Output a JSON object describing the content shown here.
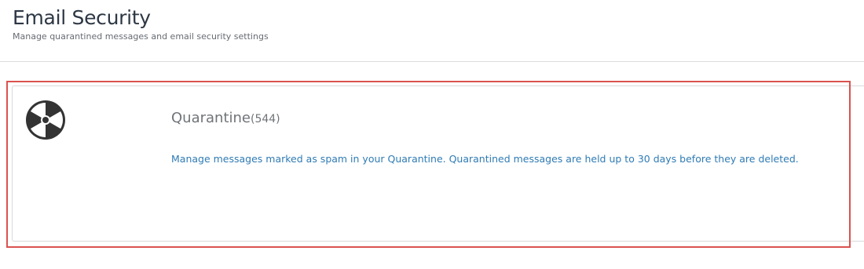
{
  "header": {
    "title": "Email Security",
    "subtitle": "Manage quarantined messages and email security settings"
  },
  "quarantine_card": {
    "icon": "radiation-icon",
    "title": "Quarantine",
    "count": "(544)",
    "description": "Manage messages marked as spam in your Quarantine. Quarantined messages are held up to 30 days before they are deleted.",
    "description_color": "#2f7bb4",
    "highlight_color": "#d9534f"
  }
}
